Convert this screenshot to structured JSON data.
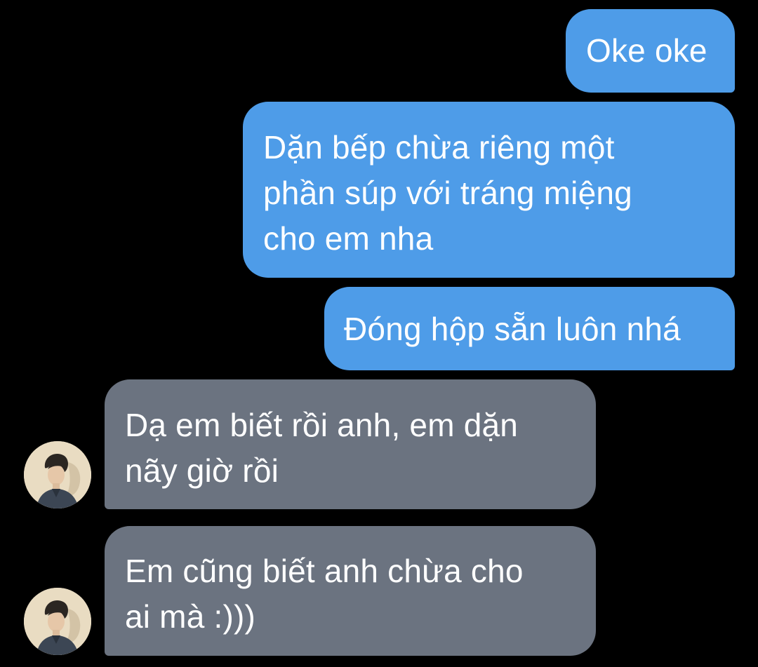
{
  "theme": {
    "background": "#000000",
    "sent_bubble_color": "#4e9ce8",
    "received_bubble_color": "#6b7380",
    "text_color": "#ffffff"
  },
  "messages": [
    {
      "direction": "sent",
      "text": "Oke oke"
    },
    {
      "direction": "sent",
      "text": "Dặn bếp chừa riêng một\nphần súp với tráng miệng\ncho em nha"
    },
    {
      "direction": "sent",
      "text": "Đóng hộp sẵn luôn nhá"
    },
    {
      "direction": "received",
      "text": "Dạ em biết rồi anh, em dặn\nnãy giờ rồi",
      "avatar_icon": "contact-avatar"
    },
    {
      "direction": "received",
      "text": "Em cũng biết anh chừa cho\nai mà :)))",
      "avatar_icon": "contact-avatar"
    }
  ]
}
